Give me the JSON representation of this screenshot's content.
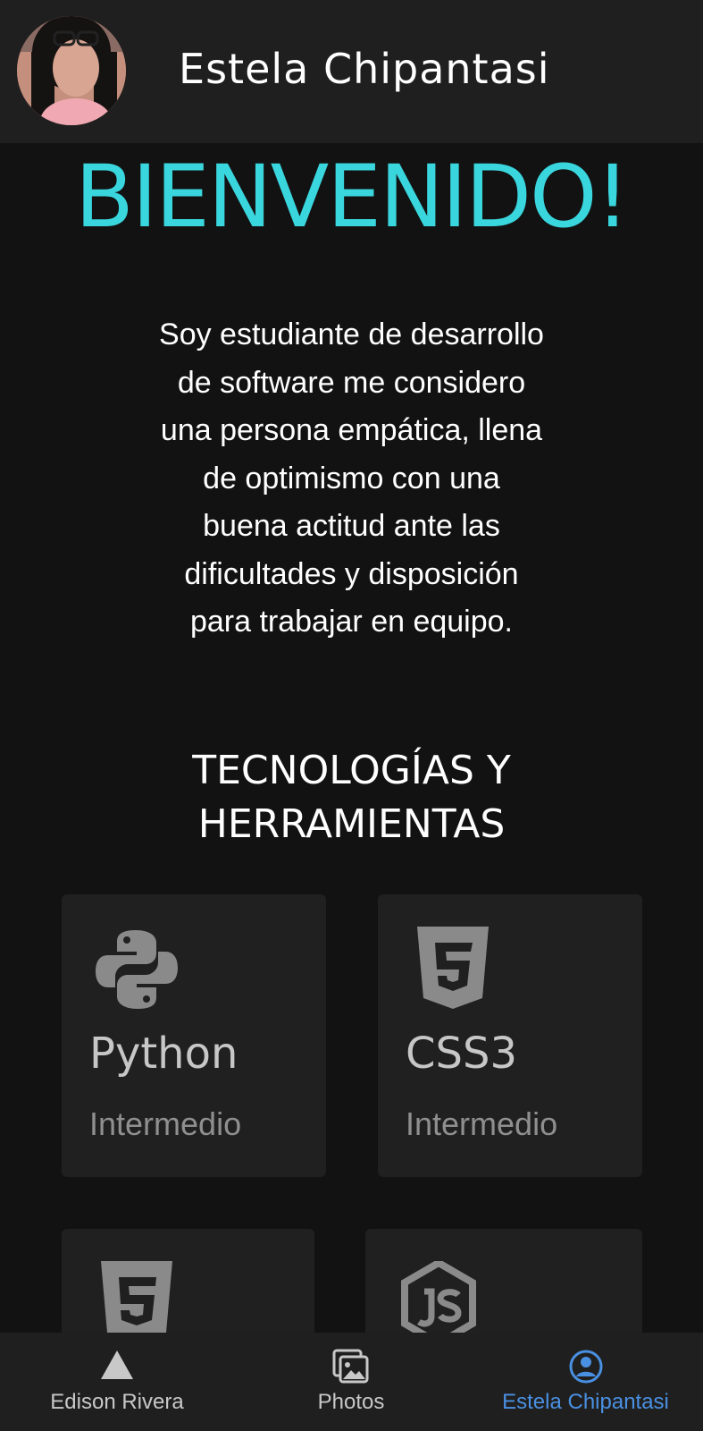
{
  "header": {
    "name": "Estela Chipantasi",
    "avatar_icon": "profile-photo"
  },
  "hero": {
    "welcome": "BIENVENIDO!",
    "bio_lines": [
      "Soy estudiante de desarrollo",
      "de software me considero",
      "una persona empática, llena",
      "de optimismo con una",
      "buena actitud ante las",
      "dificultades y disposición",
      "para trabajar en equipo."
    ]
  },
  "section": {
    "title_line1": "TECNOLOGÍAS Y",
    "title_line2": "HERRAMIENTAS"
  },
  "technologies": [
    {
      "name": "Python",
      "level": "Intermedio",
      "icon": "python-icon"
    },
    {
      "name": "CSS3",
      "level": "Intermedio",
      "icon": "css3-icon"
    },
    {
      "name": "",
      "level": "",
      "icon": "html5-icon"
    },
    {
      "name": "",
      "level": "",
      "icon": "nodejs-icon"
    }
  ],
  "bottom_nav": {
    "items": [
      {
        "label": "Edison Rivera",
        "icon": "triangle-icon",
        "active": false
      },
      {
        "label": "Photos",
        "icon": "photos-icon",
        "active": false
      },
      {
        "label": "Estela Chipantasi",
        "icon": "person-circle-icon",
        "active": true
      }
    ]
  },
  "colors": {
    "background": "#121212",
    "header": "#1f1f1f",
    "card": "#202020",
    "accent": "#3ad6de",
    "active_nav": "#4a90e2"
  }
}
